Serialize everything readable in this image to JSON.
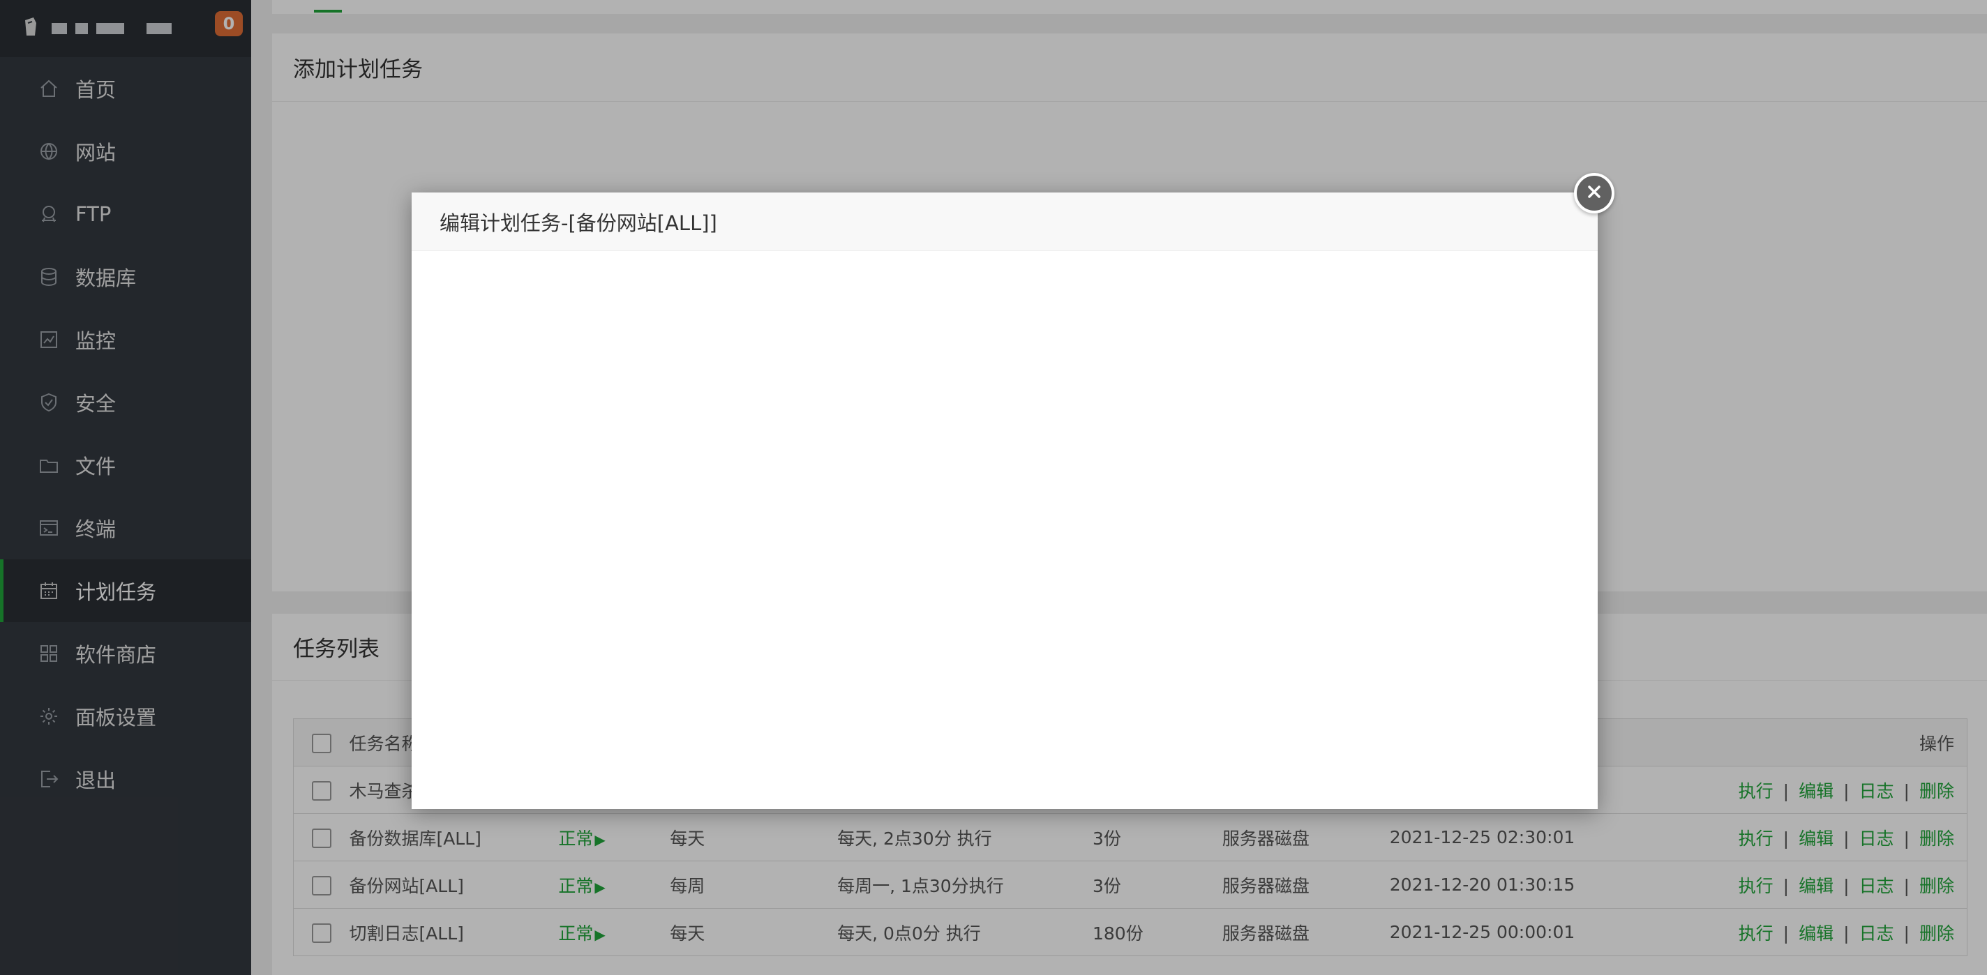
{
  "sidebar": {
    "badge": "0",
    "items": [
      {
        "label": "首页",
        "icon": "home-icon"
      },
      {
        "label": "网站",
        "icon": "globe-icon"
      },
      {
        "label": "FTP",
        "icon": "ftp-icon"
      },
      {
        "label": "数据库",
        "icon": "database-icon"
      },
      {
        "label": "监控",
        "icon": "monitor-icon"
      },
      {
        "label": "安全",
        "icon": "shield-icon"
      },
      {
        "label": "文件",
        "icon": "folder-icon"
      },
      {
        "label": "终端",
        "icon": "terminal-icon"
      },
      {
        "label": "计划任务",
        "icon": "calendar-icon",
        "active": true
      },
      {
        "label": "软件商店",
        "icon": "apps-icon"
      },
      {
        "label": "面板设置",
        "icon": "gear-icon"
      },
      {
        "label": "退出",
        "icon": "logout-icon"
      }
    ]
  },
  "add_panel": {
    "title": "添加计划任务"
  },
  "list_panel": {
    "title": "任务列表",
    "headers": {
      "name": "任务名称",
      "ops": "操作"
    },
    "rows": [
      {
        "name": "木马查杀",
        "status": "",
        "cycle": "",
        "time": "",
        "save": "",
        "target": "",
        "last": ""
      },
      {
        "name": "备份数据库[ALL]",
        "status": "正常",
        "cycle": "每天",
        "time": "每天, 2点30分 执行",
        "save": "3份",
        "target": "服务器磁盘",
        "last": "2021-12-25 02:30:01"
      },
      {
        "name": "备份网站[ALL]",
        "status": "正常",
        "cycle": "每周",
        "time": "每周一, 1点30分执行",
        "save": "3份",
        "target": "服务器磁盘",
        "last": "2021-12-20 01:30:15"
      },
      {
        "name": "切割日志[ALL]",
        "status": "正常",
        "cycle": "每天",
        "time": "每天, 0点0分 执行",
        "save": "180份",
        "target": "服务器磁盘",
        "last": "2021-12-25 00:00:01"
      }
    ],
    "ops": {
      "run": "执行",
      "edit": "编辑",
      "log": "日志",
      "delete": "删除",
      "sep": "|"
    }
  },
  "modal": {
    "title": "编辑计划任务-[备份网站[ALL]]"
  },
  "colors": {
    "accent": "#20a53a",
    "sidebar_bg": "#33383f",
    "badge": "#e06d36"
  }
}
